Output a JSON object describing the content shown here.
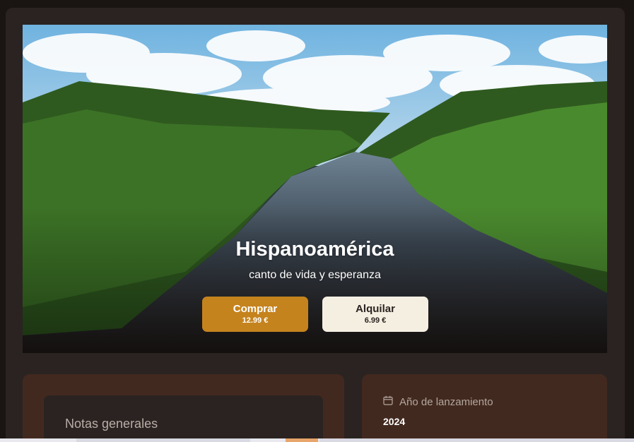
{
  "hero": {
    "title": "Hispanoamérica",
    "subtitle": "canto de vida y esperanza"
  },
  "actions": {
    "buy": {
      "label": "Comprar",
      "price": "12.99 €"
    },
    "rent": {
      "label": "Alquilar",
      "price": "6.99 €"
    }
  },
  "notes": {
    "title": "Notas generales"
  },
  "details": {
    "release_year_label": "Año de lanzamiento",
    "release_year_value": "2024",
    "icon": "calendar-icon"
  },
  "colors": {
    "background": "#1a1413",
    "card": "#2a2321",
    "panel": "#42291f",
    "accent": "#c5831e",
    "light_button": "#f5efe2"
  }
}
